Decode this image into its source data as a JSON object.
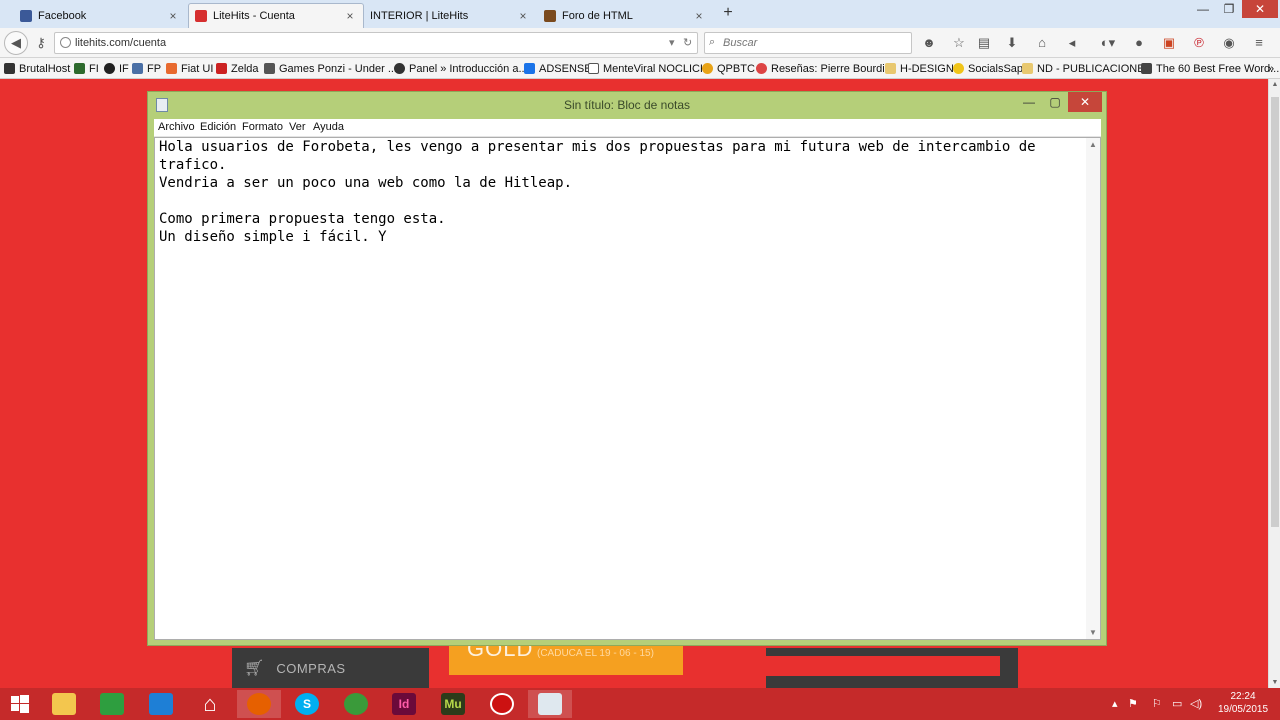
{
  "browser": {
    "tabs": [
      {
        "label": "Facebook",
        "active": false,
        "icon_color": "#3b5998",
        "icon": "facebook-icon"
      },
      {
        "label": "LiteHits - Cuenta",
        "active": true,
        "icon_color": "#d62f2f",
        "icon": "litehits-icon"
      },
      {
        "label": "INTERIOR | LiteHits",
        "active": false,
        "icon_color": "#ffffff",
        "icon": "blank-page-icon"
      },
      {
        "label": "Foro de HTML",
        "active": false,
        "icon_color": "#7a4a1e",
        "icon": "forum-icon"
      }
    ],
    "new_tab": "+",
    "window_controls": {
      "minimize": "—",
      "maximize": "❐",
      "close": "✕"
    },
    "url": "litehits.com/cuenta",
    "search_placeholder": "Buscar",
    "bookmarks": [
      {
        "label": "BrutalHost",
        "icon_color": "#333333"
      },
      {
        "label": "FI",
        "icon_color": "#2d6a2d"
      },
      {
        "label": "IF",
        "icon_color": "#222222"
      },
      {
        "label": "FP",
        "icon_color": "#4a6fa5"
      },
      {
        "label": "Fiat UI",
        "icon_color": "#e86a2f"
      },
      {
        "label": "Zelda",
        "icon_color": "#cc2222"
      },
      {
        "label": "Games Ponzi - Under ...",
        "icon_color": "#555555"
      },
      {
        "label": "Panel » Introducción a...",
        "icon_color": "#333333"
      },
      {
        "label": "ADSENSE",
        "icon_color": "#1a73e8"
      },
      {
        "label": "MenteViral NOCLICK",
        "icon_color": "#ffffff"
      },
      {
        "label": "QPBTC",
        "icon_color": "#e8a317"
      },
      {
        "label": "Reseñas: Pierre Bourdi...",
        "icon_color": "#d44"
      },
      {
        "label": "H-DESIGN",
        "icon_color": "#e8c870"
      },
      {
        "label": "SocialsSap",
        "icon_color": "#f0c419"
      },
      {
        "label": "ND - PUBLICACIONES",
        "icon_color": "#e8c870"
      },
      {
        "label": "The 60 Best Free Word...",
        "icon_color": "#444444"
      }
    ],
    "bookmarks_overflow": "»"
  },
  "page_behind": {
    "compras_label": "COMPRAS",
    "gold_label": "GOLD",
    "gold_expiry": "(CADUCA EL 19 - 06 - 15)",
    "background_color": "#e8302f"
  },
  "notepad": {
    "title": "Sin título: Bloc de notas",
    "menu": [
      "Archivo",
      "Edición",
      "Formato",
      "Ver",
      "Ayuda"
    ],
    "content": "Hola usuarios de Forobeta, les vengo a presentar mis dos propuestas para mi futura web de intercambio de\ntrafico.\nVendria a ser un poco una web como la de Hitleap.\n\nComo primera propuesta tengo esta.\nUn diseño simple i fácil. Y",
    "controls": {
      "minimize": "—",
      "maximize": "▢",
      "close": "✕"
    }
  },
  "taskbar": {
    "apps": [
      {
        "name": "file-explorer",
        "label": "",
        "color": "#f3c64e",
        "active": false
      },
      {
        "name": "store",
        "label": "",
        "color": "#2e9e3f",
        "active": false
      },
      {
        "name": "outlook",
        "label": "",
        "color": "#1e7fd6",
        "active": false
      },
      {
        "name": "home",
        "label": "",
        "color": "#ffffff",
        "active": false
      },
      {
        "name": "firefox",
        "label": "",
        "color": "#e66000",
        "active": true
      },
      {
        "name": "skype",
        "label": "S",
        "color": "#00aff0",
        "active": false
      },
      {
        "name": "chrome",
        "label": "",
        "color": "#3a9a3a",
        "active": false
      },
      {
        "name": "indesign",
        "label": "Id",
        "color": "#6b0a3a",
        "active": false
      },
      {
        "name": "muse",
        "label": "Mu",
        "color": "#2d3b1a",
        "active": false
      },
      {
        "name": "recorder",
        "label": "",
        "color": "#cc1111",
        "active": false
      },
      {
        "name": "notepad",
        "label": "",
        "color": "#dfe8ef",
        "active": true
      }
    ],
    "time": "22:24",
    "date": "19/05/2015"
  }
}
